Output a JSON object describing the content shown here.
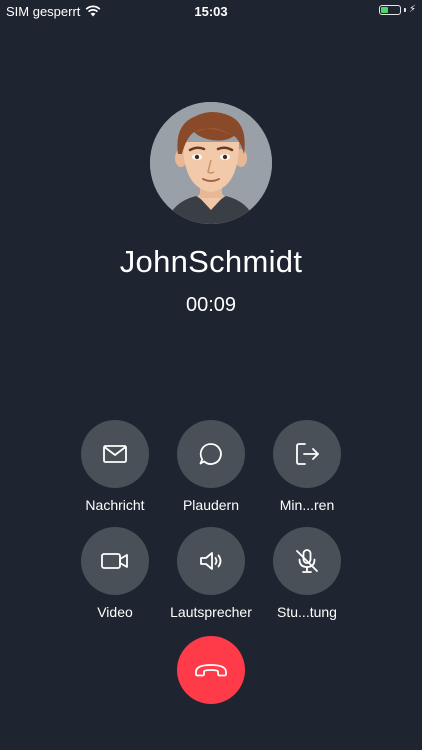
{
  "status_bar": {
    "carrier": "SIM gesperrt",
    "time": "15:03",
    "battery_level": 0.45,
    "battery_color": "#4cd964"
  },
  "caller": {
    "name": "JohnSchmidt",
    "duration": "00:09"
  },
  "actions": [
    {
      "label": "Nachricht",
      "icon": "envelope-icon"
    },
    {
      "label": "Plaudern",
      "icon": "chat-bubble-icon"
    },
    {
      "label": "Min...ren",
      "icon": "exit-icon"
    },
    {
      "label": "Video",
      "icon": "video-camera-icon"
    },
    {
      "label": "Lautsprecher",
      "icon": "speaker-icon"
    },
    {
      "label": "Stu...tung",
      "icon": "microphone-muted-icon"
    }
  ],
  "end_call": {
    "icon": "phone-hangup-icon",
    "color": "#ff3b4a"
  },
  "colors": {
    "background": "#1e2430",
    "button_background": "#4a5058"
  }
}
